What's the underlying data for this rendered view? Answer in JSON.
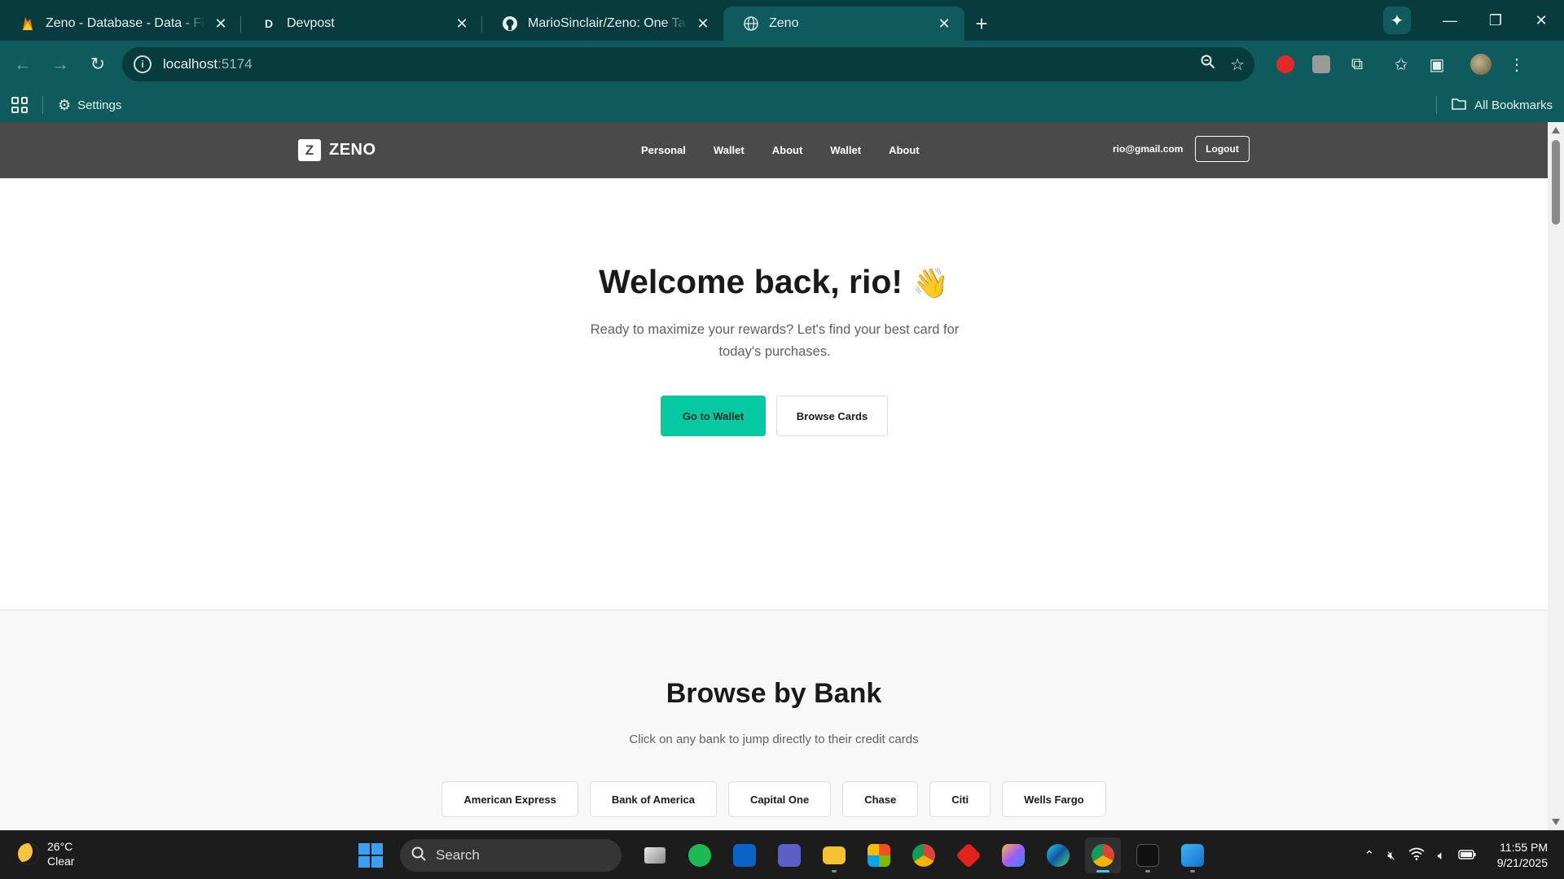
{
  "browser": {
    "tabs": [
      {
        "title": "Zeno - Database - Data - Firebase",
        "icon": "firebase-icon",
        "active": false
      },
      {
        "title": "Devpost",
        "icon": "devpost-icon",
        "active": false
      },
      {
        "title": "MarioSinclair/Zeno: One Tap, M",
        "icon": "github-icon",
        "active": false
      },
      {
        "title": "Zeno",
        "icon": "globe-icon",
        "active": true
      }
    ],
    "new_tab": "+",
    "url_host": "localhost",
    "url_port": ":5174",
    "bookmarks": {
      "settings_label": "Settings",
      "all_bookmarks_label": "All Bookmarks"
    }
  },
  "site": {
    "brand_mark": "Z",
    "brand_name": "ZENO",
    "nav": [
      "Personal",
      "Wallet",
      "About",
      "Wallet",
      "About"
    ],
    "user_email": "rio@gmail.com",
    "logout_label": "Logout"
  },
  "hero": {
    "title": "Welcome back, rio!",
    "emoji": "👋",
    "subtitle": "Ready to maximize your rewards? Let's find your best card for today's purchases.",
    "primary_button": "Go to Wallet",
    "secondary_button": "Browse Cards"
  },
  "browse": {
    "title": "Browse by Bank",
    "subtitle": "Click on any bank to jump directly to their credit cards",
    "banks": [
      "American Express",
      "Bank of America",
      "Capital One",
      "Chase",
      "Citi",
      "Wells Fargo"
    ]
  },
  "taskbar": {
    "weather_temp": "26°C",
    "weather_desc": "Clear",
    "search_placeholder": "Search",
    "time": "11:55 PM",
    "date": "9/21/2025"
  },
  "colors": {
    "chrome_dark": "#073b3e",
    "chrome": "#0f5a5d",
    "site_nav": "#4a4a4a",
    "accent": "#06c9a2"
  }
}
